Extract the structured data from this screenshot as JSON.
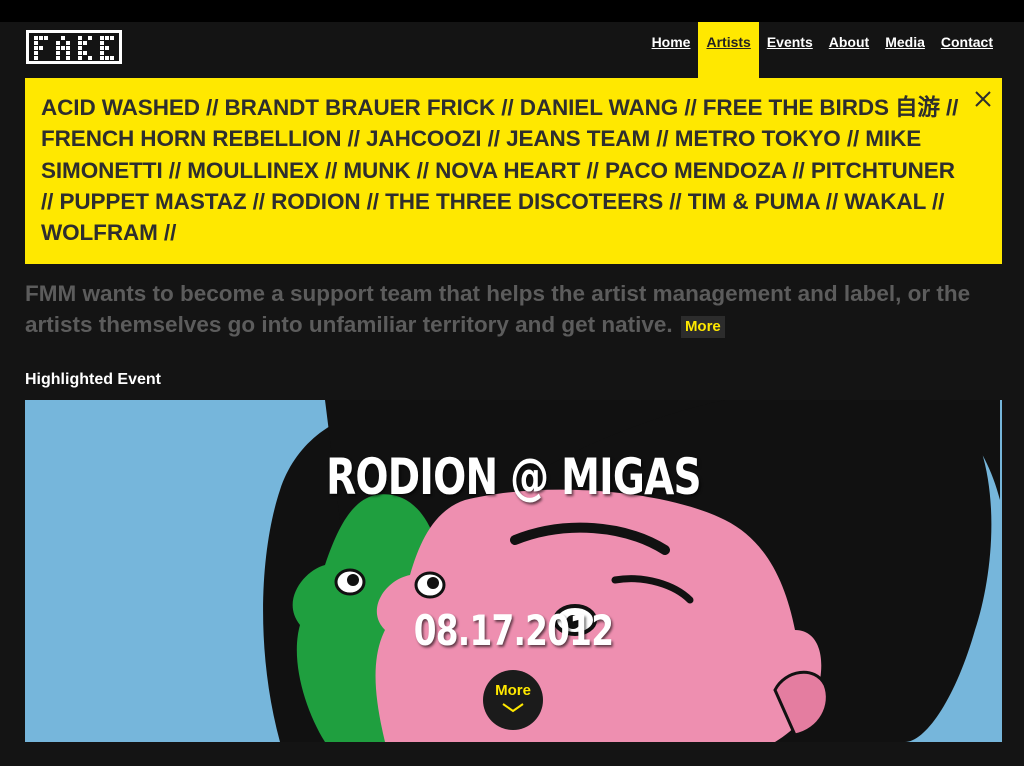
{
  "logo": {
    "text": "FAKE"
  },
  "nav": [
    {
      "label": "Home",
      "active": false
    },
    {
      "label": "Artists",
      "active": true
    },
    {
      "label": "Events",
      "active": false
    },
    {
      "label": "About",
      "active": false
    },
    {
      "label": "Media",
      "active": false
    },
    {
      "label": "Contact",
      "active": false
    }
  ],
  "artists_panel": {
    "text": "ACID WASHED // BRANDT BRAUER FRICK // DANIEL WANG // FREE THE BIRDS 自游 // FRENCH HORN REBELLION // JAHCOOZI // JEANS TEAM // METRO TOKYO // MIKE SIMONETTI // MOULLINEX // MUNK // NOVA HEART // PACO MENDOZA // PITCHTUNER // PUPPET MASTAZ // RODION // THE THREE DISCOTEERS // TIM & PUMA // WAKAL // WOLFRAM //",
    "close_icon": "close-icon"
  },
  "intro": {
    "text": "FMM wants to become a support team that helps the artist management and label, or the artists themselves go into unfamiliar territory and get native.",
    "more_label": "More"
  },
  "highlighted": {
    "heading": "Highlighted Event",
    "title": "RODION @ MIGAS",
    "date": "08.17.2012",
    "more_label": "More",
    "more_icon": "chevron-down-icon"
  },
  "colors": {
    "accent": "#ffe800",
    "background": "#141414",
    "banner_blue": "#76b6db",
    "banner_pink": "#ee8fb0",
    "banner_green": "#1f9f3f"
  }
}
